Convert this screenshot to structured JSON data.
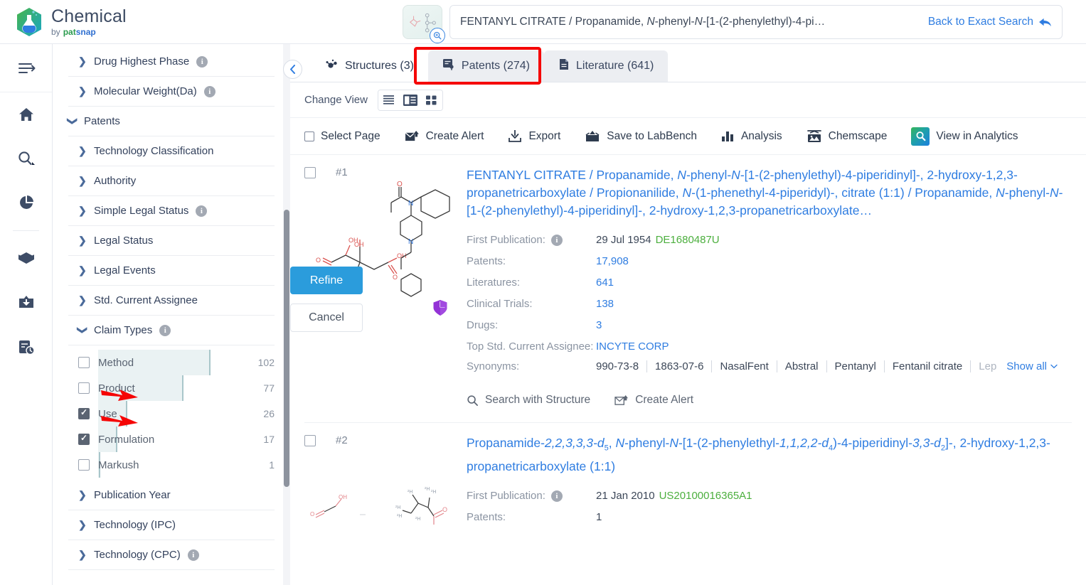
{
  "header": {
    "brand_title": "Chemical",
    "brand_by": "by",
    "brand_pat": "pat",
    "brand_snap": "snap",
    "search_value_pre": "FENTANYL CITRATE / Propanamide, ",
    "search_value_i1": "N",
    "search_value_mid": "-phenyl-",
    "search_value_i2": "N",
    "search_value_post": "-[1-(2-phenylethyl)-4-pi…",
    "back_to_exact": "Back to Exact Search",
    "structure_button": "structure-draw-button"
  },
  "rail": {
    "items": [
      {
        "name": "menu-collapse-icon",
        "glyph": "menu"
      },
      {
        "name": "home-icon",
        "glyph": "home"
      },
      {
        "name": "search-icon",
        "glyph": "search"
      },
      {
        "name": "analytics-pie-icon",
        "glyph": "pie"
      },
      {
        "name": "package-icon",
        "glyph": "box"
      },
      {
        "name": "inbox-upload-icon",
        "glyph": "inbox"
      },
      {
        "name": "history-report-icon",
        "glyph": "history"
      }
    ]
  },
  "filters": {
    "rows": [
      {
        "label": "Drug Highest Phase",
        "expanded": false,
        "info": true,
        "sub": true
      },
      {
        "label": "Molecular Weight(Da)",
        "expanded": false,
        "info": true,
        "sub": true
      },
      {
        "label": "Patents",
        "expanded": true,
        "info": false,
        "sub": false
      },
      {
        "label": "Technology Classification",
        "expanded": false,
        "info": false,
        "sub": true
      },
      {
        "label": "Authority",
        "expanded": false,
        "info": false,
        "sub": true
      },
      {
        "label": "Simple Legal Status",
        "expanded": false,
        "info": true,
        "sub": true
      },
      {
        "label": "Legal Status",
        "expanded": false,
        "info": false,
        "sub": true
      },
      {
        "label": "Legal Events",
        "expanded": false,
        "info": false,
        "sub": true
      },
      {
        "label": "Std. Current Assignee",
        "expanded": false,
        "info": false,
        "sub": true
      },
      {
        "label": "Claim Types",
        "expanded": true,
        "info": true,
        "sub": true
      }
    ],
    "claim_types": [
      {
        "label": "Method",
        "count": "102",
        "checked": false,
        "bar_pct": 100
      },
      {
        "label": "Product",
        "count": "77",
        "checked": false,
        "bar_pct": 76
      },
      {
        "label": "Use",
        "count": "26",
        "checked": true,
        "bar_pct": 26
      },
      {
        "label": "Formulation",
        "count": "17",
        "checked": true,
        "bar_pct": 17
      },
      {
        "label": "Markush",
        "count": "1",
        "checked": false,
        "bar_pct": 2
      }
    ],
    "rows_after": [
      {
        "label": "Publication Year",
        "expanded": false,
        "info": false,
        "sub": true
      },
      {
        "label": "Technology (IPC)",
        "expanded": false,
        "info": false,
        "sub": true
      },
      {
        "label": "Technology (CPC)",
        "expanded": false,
        "info": true,
        "sub": true
      }
    ],
    "refine_label": "Refine",
    "cancel_label": "Cancel"
  },
  "main": {
    "tabs": [
      {
        "label": "Structures (3)",
        "icon": "structures-icon",
        "active": true,
        "highlighted": false
      },
      {
        "label": "Patents (274)",
        "icon": "patents-icon",
        "active": false,
        "highlighted": true
      },
      {
        "label": "Literature (641)",
        "icon": "literature-icon",
        "active": false,
        "highlighted": false
      }
    ],
    "change_view_label": "Change View",
    "view_modes": [
      "list-view",
      "detail-view",
      "grid-view"
    ],
    "active_view_mode": "detail-view",
    "toolbar": [
      {
        "label": "Select Page",
        "icon": "checkbox-icon"
      },
      {
        "label": "Create Alert",
        "icon": "alert-mail-icon"
      },
      {
        "label": "Export",
        "icon": "download-icon"
      },
      {
        "label": "Save to LabBench",
        "icon": "labbench-icon"
      },
      {
        "label": "Analysis",
        "icon": "bar-chart-icon"
      },
      {
        "label": "Chemscape",
        "icon": "chemscape-icon"
      },
      {
        "label": "View in Analytics",
        "icon": "view-in-analytics-icon"
      }
    ],
    "results": [
      {
        "index": "#1",
        "title_parts": [
          {
            "t": "FENTANYL CITRATE / Propanamide, ",
            "i": false
          },
          {
            "t": "N",
            "i": true
          },
          {
            "t": "-phenyl-",
            "i": false
          },
          {
            "t": "N",
            "i": true
          },
          {
            "t": "-[1-(2-phenylethyl)-4-piperidinyl]-, 2-hydroxy-1,2,3-propanetricarboxylate / Propionanilide, ",
            "i": false
          },
          {
            "t": "N",
            "i": true
          },
          {
            "t": "-(1-phenethyl-4-piperidyl)-, citrate (1:1) / Propanamide, ",
            "i": false
          },
          {
            "t": "N",
            "i": true
          },
          {
            "t": "-phenyl-",
            "i": false
          },
          {
            "t": "N",
            "i": true
          },
          {
            "t": "-[1-(2-phenylethyl)-4-piperidinyl]-, 2-hydroxy-1,2,3-propanetricarboxylate…",
            "i": false
          }
        ],
        "fields": [
          {
            "label": "First Publication:",
            "info": true,
            "value": "29 Jul 1954",
            "pubnum": "DE1680487U",
            "link": false
          },
          {
            "label": "Patents:",
            "info": false,
            "value": "17,908",
            "link": true
          },
          {
            "label": "Literatures:",
            "info": false,
            "value": "641",
            "link": true
          },
          {
            "label": "Clinical Trials:",
            "info": false,
            "value": "138",
            "link": true
          },
          {
            "label": "Drugs:",
            "info": false,
            "value": "3",
            "link": true
          },
          {
            "label": "Top Std. Current Assignee:",
            "info": false,
            "value": "INCYTE CORP",
            "link": true,
            "two_line": true
          }
        ],
        "synonyms_label": "Synonyms:",
        "synonyms": [
          "990-73-8",
          "1863-07-6",
          "NasalFent",
          "Abstral",
          "Pentanyl",
          "Fentanil citrate"
        ],
        "synonyms_truncated": "Lep",
        "show_all": "Show all",
        "actions": [
          {
            "label": "Search with Structure",
            "icon": "search-icon"
          },
          {
            "label": "Create Alert",
            "icon": "alert-mail-icon"
          }
        ],
        "badge": "shield-badge-icon"
      },
      {
        "index": "#2",
        "title_parts": [
          {
            "t": "Propanamide-",
            "i": false
          },
          {
            "t": "2,2,3,3,3-d",
            "i": true,
            "sub": "5"
          },
          {
            "t": ", ",
            "i": false
          },
          {
            "t": "N",
            "i": true
          },
          {
            "t": "-phenyl-",
            "i": false
          },
          {
            "t": "N",
            "i": true
          },
          {
            "t": "-[1-(2-phenylethyl-",
            "i": false
          },
          {
            "t": "1,1,2,2-d",
            "i": true,
            "sub": "4"
          },
          {
            "t": ")-4-piperidinyl-",
            "i": false
          },
          {
            "t": "3,3-d",
            "i": true,
            "sub": "2"
          },
          {
            "t": "]-, 2-hydroxy-1,2,3-propanetricarboxylate (1:1)",
            "i": false
          }
        ],
        "fields": [
          {
            "label": "First Publication:",
            "info": true,
            "value": "21 Jan 2010",
            "pubnum": "US20100016365A1",
            "link": false
          },
          {
            "label": "Patents:",
            "info": false,
            "value": "1",
            "link": false
          }
        ]
      }
    ]
  },
  "colors": {
    "accent_blue": "#2f7de1",
    "refine_blue": "#2b9cdc",
    "pub_green": "#4caf3e",
    "highlight_red": "#f50505",
    "bar_fill": "#eaf2f3",
    "shield_purple": "#9333d6"
  }
}
